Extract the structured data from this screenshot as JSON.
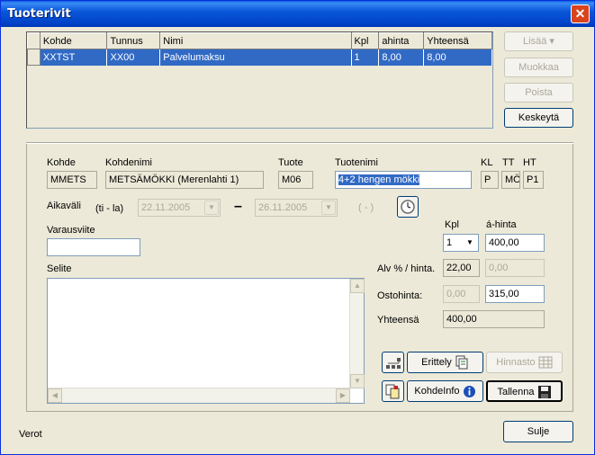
{
  "window": {
    "title": "Tuoterivit",
    "close_glyph": "✕"
  },
  "grid": {
    "columns": [
      "Kohde",
      "Tunnus",
      "Nimi",
      "Kpl",
      "ahinta",
      "Yhteensä"
    ],
    "rows": [
      [
        "XXTST",
        "XX00",
        "Palvelumaksu",
        "1",
        "8,00",
        "8,00"
      ]
    ]
  },
  "side_buttons": {
    "lisaa": "Lisää",
    "muokkaa": "Muokkaa",
    "poista": "Poista",
    "keskeyta": "Keskeytä"
  },
  "form": {
    "kohde_label": "Kohde",
    "kohde_value": "MMETS",
    "kohdenimi_label": "Kohdenimi",
    "kohdenimi_value": "METSÄMÖKKI (Merenlahti 1)",
    "tuote_label": "Tuote",
    "tuote_value": "M06",
    "tuotenimi_label": "Tuotenimi",
    "tuotenimi_value": "4+2 hengen mökki",
    "kl_label": "KL",
    "kl_value": "P",
    "tt_label": "TT",
    "tt_value": "MÖ",
    "ht_label": "HT",
    "ht_value": "P1",
    "aikavali_label": "Aikaväli",
    "aikavali_days": "(ti - la)",
    "date_from": "22.11.2005",
    "date_dash": "–",
    "date_to": "26.11.2005",
    "date_extra": "( - )",
    "varausviite_label": "Varausviite",
    "varausviite_value": "",
    "selite_label": "Selite",
    "kpl_label": "Kpl",
    "kpl_value": "1",
    "ahinta_label": "á-hinta",
    "ahinta_value": "400,00",
    "alv_label": "Alv % / hinta.",
    "alv_value": "22,00",
    "alv_hinta_value": "0,00",
    "ostohinta_label": "Ostohinta:",
    "ostohinta_left_value": "0,00",
    "ostohinta_value": "315,00",
    "yhteensa_label": "Yhteensä",
    "yhteensa_value": "400,00"
  },
  "action_buttons": {
    "erittely": "Erittely",
    "hinnasto": "Hinnasto",
    "kohdeinfo": "KohdeInfo",
    "tallenna": "Tallenna",
    "sulje": "Sulje"
  },
  "footer": {
    "verot": "Verot"
  },
  "colors": {
    "title_blue": "#0a57d9",
    "selection": "#316ac5",
    "face": "#ece9d8"
  }
}
